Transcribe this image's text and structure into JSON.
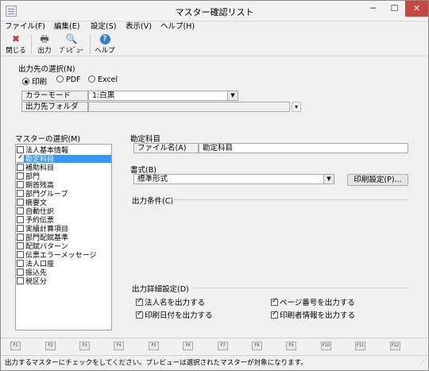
{
  "window": {
    "title": "マスター確認リスト",
    "min_glyph": "─",
    "max_glyph": "☐",
    "close_glyph": "✕"
  },
  "menu": [
    "ファイル(F)",
    "編集(E)",
    "設定(S)",
    "表示(V)",
    "ヘルプ(H)"
  ],
  "toolbar": {
    "close_label": "閉じる",
    "output_label": "出力",
    "preview_label": "ﾌﾟﾚﾋﾞｭｰ",
    "help_label": "ヘルプ",
    "close_icon": "✖",
    "output_icon": "🖶",
    "preview_icon": "🔍",
    "help_icon": "?"
  },
  "output_dest": {
    "title": "出力先の選択(N)",
    "options": [
      "印刷",
      "PDF",
      "Excel"
    ],
    "selected": "印刷",
    "color_mode_label": "カラーモード",
    "color_mode_value": "1:白黒",
    "folder_label": "出力先フォルダ",
    "folder_value": "",
    "folder_button": "▾"
  },
  "master_select": {
    "title": "マスターの選択(M)",
    "items": [
      {
        "label": "法人基本情報",
        "checked": false,
        "selected": false
      },
      {
        "label": "勘定科目",
        "checked": true,
        "selected": true
      },
      {
        "label": "補助科目",
        "checked": false,
        "selected": false
      },
      {
        "label": "部門",
        "checked": false,
        "selected": false
      },
      {
        "label": "期首残高",
        "checked": false,
        "selected": false
      },
      {
        "label": "部門グループ",
        "checked": false,
        "selected": false
      },
      {
        "label": "摘要文",
        "checked": false,
        "selected": false
      },
      {
        "label": "自動仕訳",
        "checked": false,
        "selected": false
      },
      {
        "label": "予約伝票",
        "checked": false,
        "selected": false
      },
      {
        "label": "実績計算項目",
        "checked": false,
        "selected": false
      },
      {
        "label": "部門配賦基準",
        "checked": false,
        "selected": false
      },
      {
        "label": "配賦パターン",
        "checked": false,
        "selected": false
      },
      {
        "label": "伝票エラーメッセージ",
        "checked": false,
        "selected": false
      },
      {
        "label": "法人口座",
        "checked": false,
        "selected": false
      },
      {
        "label": "振込先",
        "checked": false,
        "selected": false
      },
      {
        "label": "税区分",
        "checked": false,
        "selected": false
      }
    ]
  },
  "detail": {
    "section_title": "勘定科目",
    "filename_label": "ファイル名(A)",
    "filename_value": "勘定科目",
    "format_label": "書式(B)",
    "format_value": "標準形式",
    "print_settings_button": "印刷設定(P)...",
    "conditions_label": "出力条件(C)",
    "output_detail_label": "出力詳細設定(D)",
    "options": [
      {
        "label": "法人名を出力する",
        "checked": true
      },
      {
        "label": "ページ番号を出力する",
        "checked": true
      },
      {
        "label": "印刷日付を出力する",
        "checked": true
      },
      {
        "label": "印刷者情報を出力する",
        "checked": true
      }
    ]
  },
  "fkeys": [
    "F1",
    "F2",
    "F3",
    "F4",
    "F5",
    "F6",
    "F7",
    "F8",
    "F9",
    "F10",
    "F11",
    "F12"
  ],
  "status": "出力するマスターにチェックをしてください。プレビューは選択されたマスターが対象になります。"
}
